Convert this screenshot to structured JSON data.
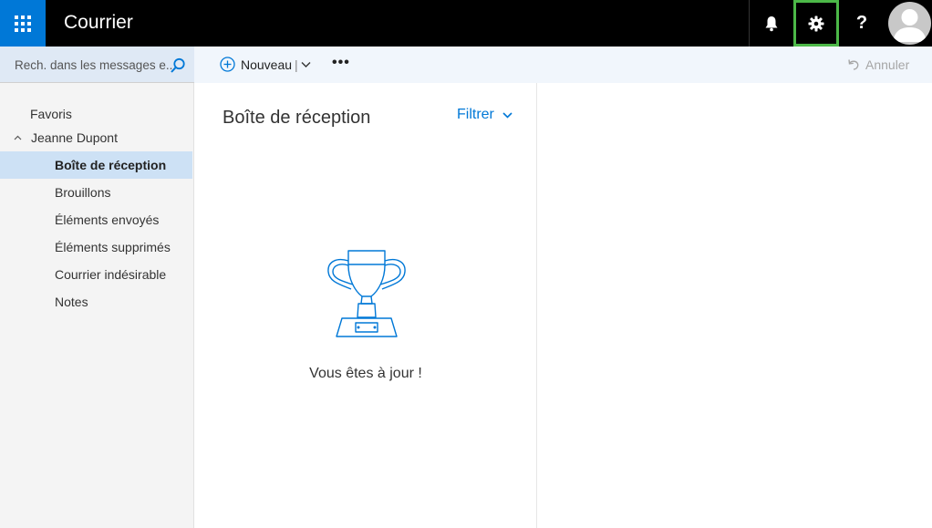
{
  "header": {
    "app_title": "Courrier",
    "help_label": "?",
    "icons": [
      "waffle-icon",
      "bell-icon",
      "gear-icon",
      "help-icon",
      "avatar"
    ]
  },
  "search": {
    "placeholder": "Rech. dans les messages e..."
  },
  "commands": {
    "new_label": "Nouveau",
    "new_separator": "|",
    "more_label": "•••",
    "undo_label": "Annuler"
  },
  "nav": {
    "favorites": "Favoris",
    "account": "Jeanne Dupont",
    "folders": [
      {
        "label": "Boîte de réception",
        "selected": true
      },
      {
        "label": "Brouillons",
        "selected": false
      },
      {
        "label": "Éléments envoyés",
        "selected": false
      },
      {
        "label": "Éléments supprimés",
        "selected": false
      },
      {
        "label": "Courrier indésirable",
        "selected": false
      },
      {
        "label": "Notes",
        "selected": false
      }
    ]
  },
  "message_list": {
    "title": "Boîte de réception",
    "filter_label": "Filtrer",
    "empty_message": "Vous êtes à jour !"
  },
  "colors": {
    "brand_blue": "#0078d7",
    "topbar": "#000000",
    "highlight_green": "#4cb848",
    "selected_bg": "#cde1f5"
  }
}
